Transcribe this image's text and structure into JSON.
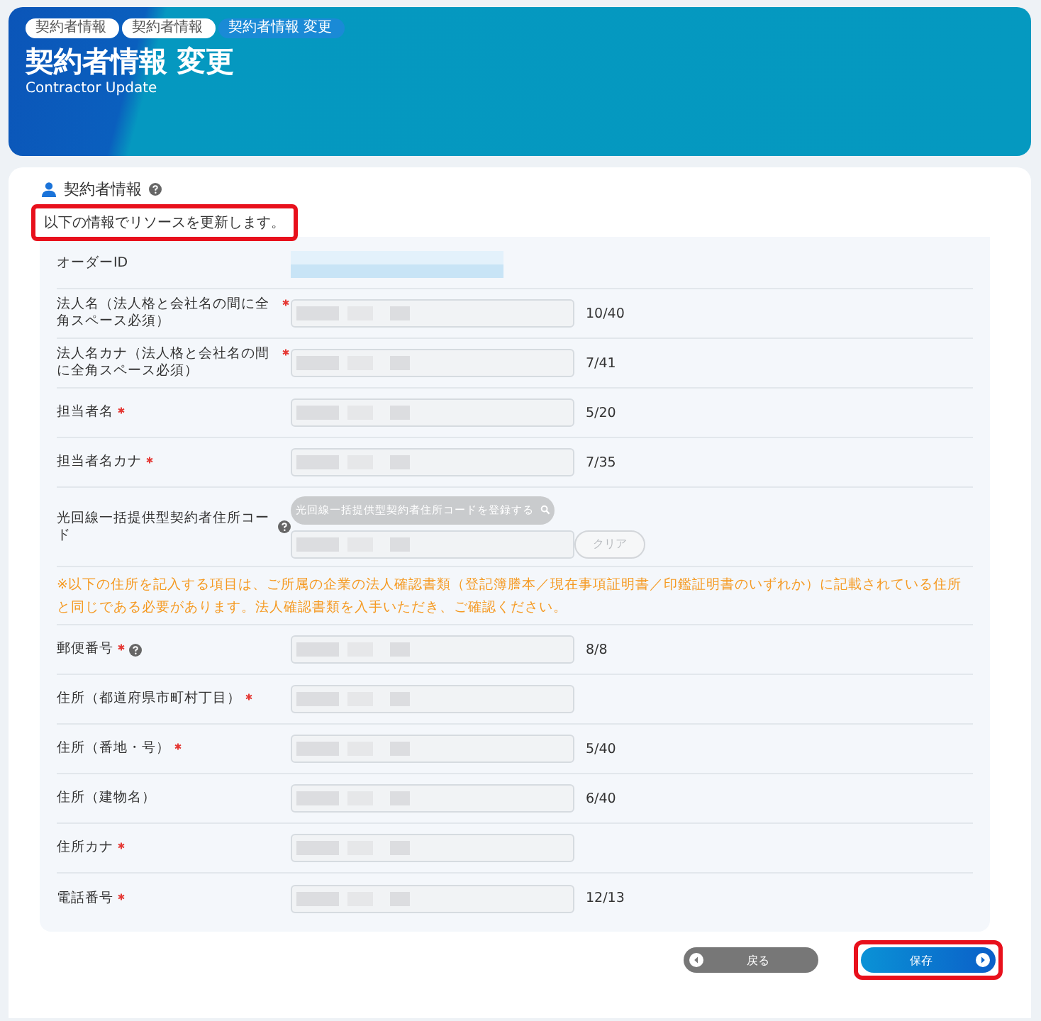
{
  "header": {
    "breadcrumbs": [
      {
        "label": "契約者情報",
        "selected": false
      },
      {
        "label": "契約者情報",
        "selected": false
      },
      {
        "label": "契約者情報 変更",
        "selected": true
      }
    ],
    "title": "契約者情報 変更",
    "subtitle": "Contractor Update"
  },
  "section": {
    "title": "契約者情報",
    "help": true,
    "message": {
      "text": "以下の情報でリソースを更新します。",
      "highlighted": true
    }
  },
  "rows": [
    {
      "kind": "display",
      "label": "オーダーID",
      "required": false,
      "help": false
    },
    {
      "kind": "input",
      "label": "法人名（法人格と会社名の間に全角スペース必須）",
      "required": true,
      "help": false,
      "counter": "10/40"
    },
    {
      "kind": "input",
      "label": "法人名カナ（法人格と会社名の間に全角スペース必須）",
      "required": true,
      "help": false,
      "counter": "7/41"
    },
    {
      "kind": "input",
      "label": "担当者名",
      "required": true,
      "help": false,
      "counter": "5/20"
    },
    {
      "kind": "input",
      "label": "担当者名カナ",
      "required": true,
      "help": false,
      "counter": "7/35"
    },
    {
      "kind": "code",
      "label": "光回線一括提供型契約者住所コード",
      "required": false,
      "help": true,
      "lookup_button": "光回線一括提供型契約者住所コードを登録する",
      "clear_button": "クリア"
    },
    {
      "kind": "notice",
      "text": "※以下の住所を記入する項目は、ご所属の企業の法人確認書類（登記簿謄本／現在事項証明書／印鑑証明書のいずれか）に記載されている住所と同じである必要があります。法人確認書類を入手いただき、ご確認ください。"
    },
    {
      "kind": "input",
      "label": "郵便番号",
      "required": true,
      "help": true,
      "counter": "8/8"
    },
    {
      "kind": "input",
      "label": "住所（都道府県市町村丁目）",
      "required": true,
      "help": false
    },
    {
      "kind": "input",
      "label": "住所（番地・号）",
      "required": true,
      "help": false,
      "counter": "5/40"
    },
    {
      "kind": "input",
      "label": "住所（建物名）",
      "required": false,
      "help": false,
      "counter": "6/40"
    },
    {
      "kind": "input",
      "label": "住所カナ",
      "required": true,
      "help": false
    },
    {
      "kind": "input",
      "label": "電話番号",
      "required": true,
      "help": false,
      "counter": "12/13"
    }
  ],
  "buttons": [
    {
      "kind": "back",
      "label": "戻る",
      "highlighted": false
    },
    {
      "kind": "save",
      "label": "保存",
      "highlighted": true
    }
  ]
}
